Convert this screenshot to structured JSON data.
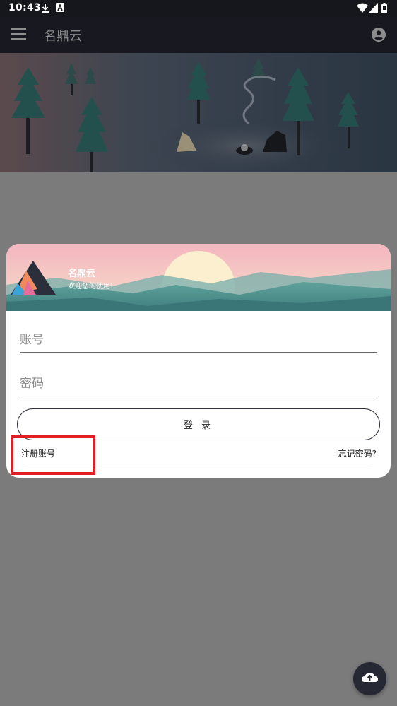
{
  "status_bar": {
    "time": "10:43"
  },
  "app_bar": {
    "title": "名鼎云"
  },
  "login_dialog": {
    "app_name": "名鼎云",
    "welcome": "欢迎您的使用!",
    "account_placeholder": "账号",
    "password_placeholder": "密码",
    "login_label": "登 录",
    "register_label": "注册账号",
    "forgot_label": "忘记密码?"
  },
  "highlight": {
    "color": "#e01e24",
    "target": "register_label"
  },
  "icons": {
    "menu": "menu-icon",
    "account": "account-circle-icon",
    "download": "download-icon",
    "notification": "a-notification-icon",
    "wifi": "wifi-icon",
    "signal": "signal-icon",
    "battery": "battery-icon",
    "logo": "triangle-logo-icon",
    "fab": "cloud-icon"
  },
  "colors": {
    "app_bar": "#171820",
    "overlay": "#7b7b7b",
    "dialog_bg": "#ffffff",
    "login_border": "#2f2f3d",
    "fab": "#262934"
  }
}
